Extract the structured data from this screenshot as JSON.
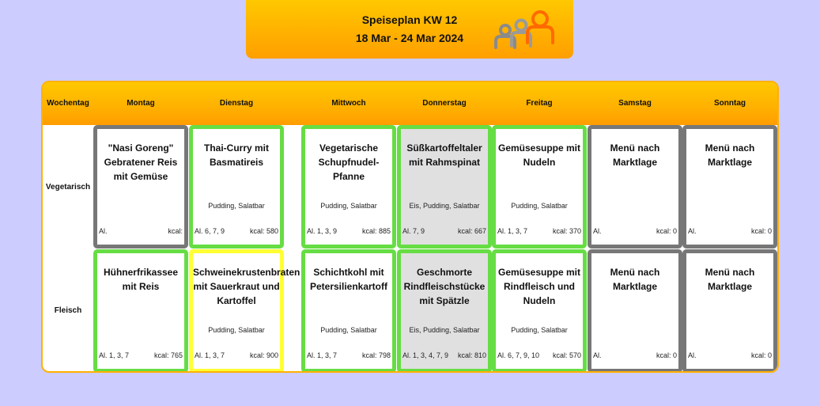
{
  "header": {
    "title": "Speiseplan KW 12",
    "date_range": "18 Mar - 24 Mar 2024",
    "logo_icon": "people-group-icon"
  },
  "columns": {
    "label_header": "Wochentag",
    "days": [
      "Montag",
      "Dienstag",
      "Mittwoch",
      "Donnerstag",
      "Freitag",
      "Samstag",
      "Sonntag"
    ]
  },
  "rows": [
    {
      "label": "Vegetarisch",
      "cards": [
        {
          "dish": "\"Nasi Goreng\" Gebratener Reis mit Gemüse",
          "extras": "",
          "allergens": "Al.",
          "kcal": "kcal:",
          "border": "gray",
          "background": "white"
        },
        {
          "dish": "Thai-Curry mit Basmatireis",
          "extras": "Pudding, Salatbar",
          "allergens": "Al. 6, 7, 9",
          "kcal": "kcal: 580",
          "border": "green",
          "background": "white"
        },
        {
          "dish": "Vegetarische Schupfnudel-Pfanne",
          "extras": "Pudding, Salatbar",
          "allergens": "Al. 1, 3, 9",
          "kcal": "kcal: 885",
          "border": "green",
          "background": "white"
        },
        {
          "dish": "Süßkartoffeltaler mit Rahmspinat",
          "extras": "Eis, Pudding, Salatbar",
          "allergens": "Al. 7, 9",
          "kcal": "kcal: 667",
          "border": "green",
          "background": "gray"
        },
        {
          "dish": "Gemüsesuppe mit Nudeln",
          "extras": "Pudding, Salatbar",
          "allergens": "Al. 1, 3, 7",
          "kcal": "kcal: 370",
          "border": "green",
          "background": "white"
        },
        {
          "dish": "Menü nach Marktlage",
          "extras": "",
          "allergens": "Al.",
          "kcal": "kcal: 0",
          "border": "gray",
          "background": "white"
        },
        {
          "dish": "Menü nach Marktlage",
          "extras": "",
          "allergens": "Al.",
          "kcal": "kcal: 0",
          "border": "gray",
          "background": "white"
        }
      ]
    },
    {
      "label": "Fleisch",
      "cards": [
        {
          "dish": "Hühnerfrikassee mit Reis",
          "extras": "",
          "allergens": "Al. 1, 3, 7",
          "kcal": "kcal: 765",
          "border": "green",
          "background": "white"
        },
        {
          "dish": "Schweinekrustenbraten mit Sauerkraut und Kartoffel",
          "extras": "Pudding, Salatbar",
          "allergens": "Al. 1, 3, 7",
          "kcal": "kcal: 900",
          "border": "yellow",
          "background": "white"
        },
        {
          "dish": "Schichtkohl mit Petersilienkartoff",
          "extras": "Pudding, Salatbar",
          "allergens": "Al. 1, 3, 7",
          "kcal": "kcal: 798",
          "border": "green",
          "background": "white"
        },
        {
          "dish": "Geschmorte Rindfleischstücke mit Spätzle",
          "extras": "Eis, Pudding, Salatbar",
          "allergens": "Al. 1, 3, 4, 7, 9",
          "kcal": "kcal: 810",
          "border": "green",
          "background": "gray"
        },
        {
          "dish": "Gemüsesuppe mit Rindfleisch und Nudeln",
          "extras": "Pudding, Salatbar",
          "allergens": "Al. 6, 7, 9, 10",
          "kcal": "kcal: 570",
          "border": "green",
          "background": "white"
        },
        {
          "dish": "Menü nach Marktlage",
          "extras": "",
          "allergens": "Al.",
          "kcal": "kcal: 0",
          "border": "gray",
          "background": "white"
        },
        {
          "dish": "Menü nach Marktlage",
          "extras": "",
          "allergens": "Al.",
          "kcal": "kcal: 0",
          "border": "gray",
          "background": "white"
        }
      ]
    }
  ],
  "colors": {
    "page_background": "#ccccff",
    "header_orange": "#ffb100",
    "border_green": "#66dd44",
    "border_gray": "#777777",
    "border_yellow": "#ffff33",
    "card_gray_background": "#e0e0e0"
  }
}
